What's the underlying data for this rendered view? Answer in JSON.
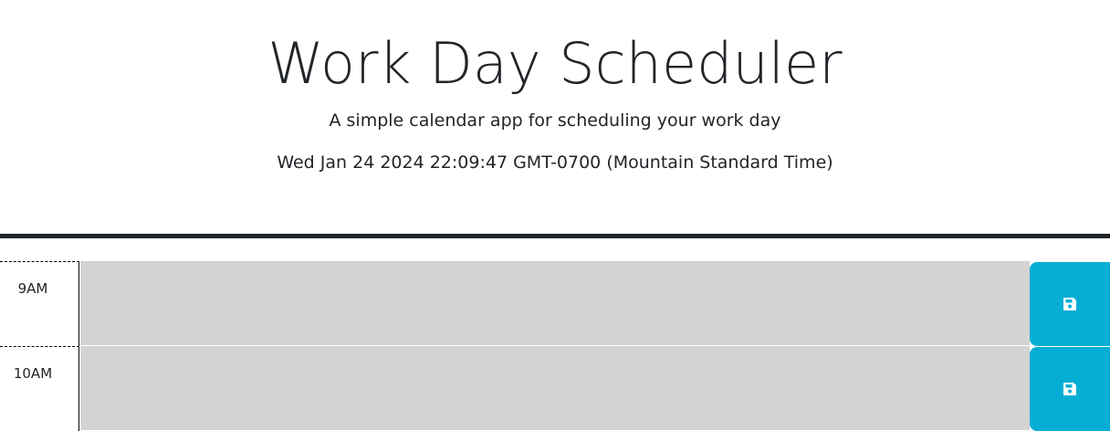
{
  "header": {
    "title": "Work Day Scheduler",
    "subtitle": "A simple calendar app for scheduling your work day",
    "current_day": "Wed Jan 24 2024 22:09:47 GMT-0700 (Mountain Standard Time)"
  },
  "time_blocks": [
    {
      "hour": "9AM",
      "description": "",
      "save_icon": "floppy-disk-icon"
    },
    {
      "hour": "10AM",
      "description": "",
      "save_icon": "floppy-disk-icon"
    }
  ],
  "colors": {
    "header_border": "#212529",
    "past_block": "#d3d3d3",
    "save_button": "#06aed5",
    "text": "#212529"
  }
}
